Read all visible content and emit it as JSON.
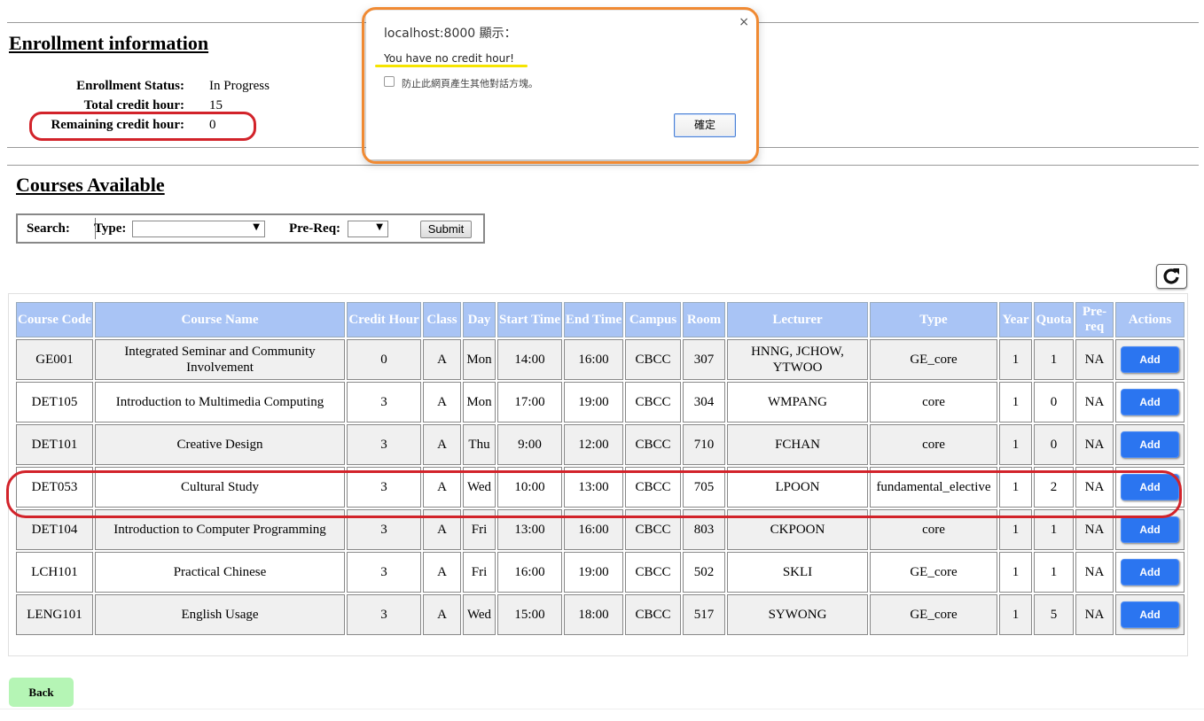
{
  "enrollment": {
    "heading": "Enrollment information",
    "status_label": "Enrollment Status:",
    "status_value": "In Progress",
    "total_label": "Total credit hour:",
    "total_value": "15",
    "remaining_label": "Remaining credit hour:",
    "remaining_value": "0"
  },
  "courses_heading": "Courses Available",
  "search": {
    "search_label": "Search:",
    "type_label": "Type:",
    "type_value": "",
    "prereq_label": "Pre-Req:",
    "prereq_value": "",
    "submit_label": "Submit"
  },
  "table": {
    "headers": [
      "Course Code",
      "Course Name",
      "Credit Hour",
      "Class",
      "Day",
      "Start Time",
      "End Time",
      "Campus",
      "Room",
      "Lecturer",
      "Type",
      "Year",
      "Quota",
      "Pre-req",
      "Actions"
    ],
    "rows": [
      [
        "GE001",
        "Integrated Seminar and Community Involvement",
        "0",
        "A",
        "Mon",
        "14:00",
        "16:00",
        "CBCC",
        "307",
        "HNNG, JCHOW, YTWOO",
        "GE_core",
        "1",
        "1",
        "NA",
        "Add"
      ],
      [
        "DET105",
        "Introduction to Multimedia Computing",
        "3",
        "A",
        "Mon",
        "17:00",
        "19:00",
        "CBCC",
        "304",
        "WMPANG",
        "core",
        "1",
        "0",
        "NA",
        "Add"
      ],
      [
        "DET101",
        "Creative Design",
        "3",
        "A",
        "Thu",
        "9:00",
        "12:00",
        "CBCC",
        "710",
        "FCHAN",
        "core",
        "1",
        "0",
        "NA",
        "Add"
      ],
      [
        "DET053",
        "Cultural Study",
        "3",
        "A",
        "Wed",
        "10:00",
        "13:00",
        "CBCC",
        "705",
        "LPOON",
        "fundamental_elective",
        "1",
        "2",
        "NA",
        "Add"
      ],
      [
        "DET104",
        "Introduction to Computer Programming",
        "3",
        "A",
        "Fri",
        "13:00",
        "16:00",
        "CBCC",
        "803",
        "CKPOON",
        "core",
        "1",
        "1",
        "NA",
        "Add"
      ],
      [
        "LCH101",
        "Practical Chinese",
        "3",
        "A",
        "Fri",
        "16:00",
        "19:00",
        "CBCC",
        "502",
        "SKLI",
        "GE_core",
        "1",
        "1",
        "NA",
        "Add"
      ],
      [
        "LENG101",
        "English Usage",
        "3",
        "A",
        "Wed",
        "15:00",
        "18:00",
        "CBCC",
        "517",
        "SYWONG",
        "GE_core",
        "1",
        "5",
        "NA",
        "Add"
      ]
    ]
  },
  "back_label": "Back",
  "dialog": {
    "title": "localhost:8000 顯示：",
    "message": "You have no credit hour!",
    "checkbox_label": "防止此網頁產生其他對話方塊。",
    "ok_label": "確定",
    "close_glyph": "×"
  },
  "colors": {
    "header_bg": "#a9c4f5",
    "add_button": "#2b75f0",
    "back_button": "#b5f5b5",
    "annotation_red": "#d2232a",
    "annotation_orange": "#f08a33",
    "annotation_yellow": "#f5e400"
  },
  "icons": {
    "refresh": "refresh-icon",
    "dropdown": "chevron-down-icon"
  }
}
